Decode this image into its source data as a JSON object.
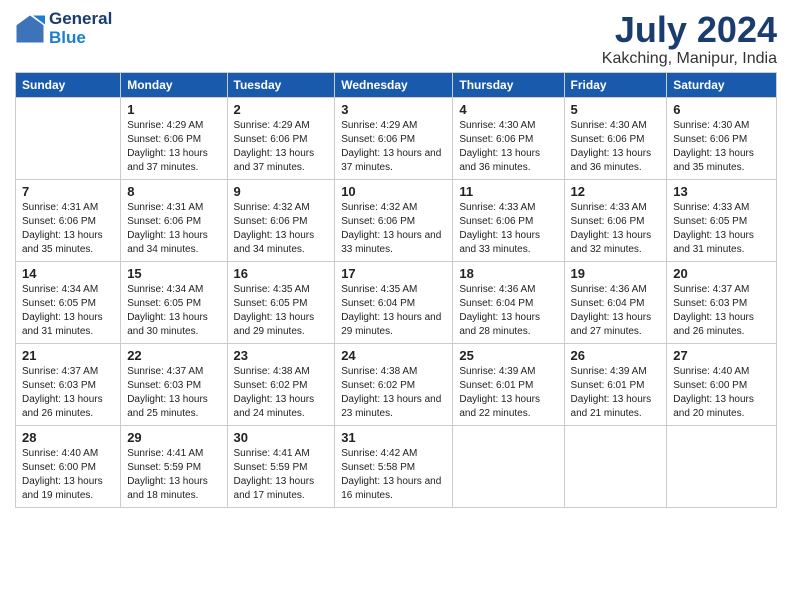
{
  "header": {
    "logo_line1": "General",
    "logo_line2": "Blue",
    "title": "July 2024",
    "subtitle": "Kakching, Manipur, India"
  },
  "days_of_week": [
    "Sunday",
    "Monday",
    "Tuesday",
    "Wednesday",
    "Thursday",
    "Friday",
    "Saturday"
  ],
  "weeks": [
    [
      {
        "day": "",
        "sunrise": "",
        "sunset": "",
        "daylight": ""
      },
      {
        "day": "1",
        "sunrise": "Sunrise: 4:29 AM",
        "sunset": "Sunset: 6:06 PM",
        "daylight": "Daylight: 13 hours and 37 minutes."
      },
      {
        "day": "2",
        "sunrise": "Sunrise: 4:29 AM",
        "sunset": "Sunset: 6:06 PM",
        "daylight": "Daylight: 13 hours and 37 minutes."
      },
      {
        "day": "3",
        "sunrise": "Sunrise: 4:29 AM",
        "sunset": "Sunset: 6:06 PM",
        "daylight": "Daylight: 13 hours and 37 minutes."
      },
      {
        "day": "4",
        "sunrise": "Sunrise: 4:30 AM",
        "sunset": "Sunset: 6:06 PM",
        "daylight": "Daylight: 13 hours and 36 minutes."
      },
      {
        "day": "5",
        "sunrise": "Sunrise: 4:30 AM",
        "sunset": "Sunset: 6:06 PM",
        "daylight": "Daylight: 13 hours and 36 minutes."
      },
      {
        "day": "6",
        "sunrise": "Sunrise: 4:30 AM",
        "sunset": "Sunset: 6:06 PM",
        "daylight": "Daylight: 13 hours and 35 minutes."
      }
    ],
    [
      {
        "day": "7",
        "sunrise": "Sunrise: 4:31 AM",
        "sunset": "Sunset: 6:06 PM",
        "daylight": "Daylight: 13 hours and 35 minutes."
      },
      {
        "day": "8",
        "sunrise": "Sunrise: 4:31 AM",
        "sunset": "Sunset: 6:06 PM",
        "daylight": "Daylight: 13 hours and 34 minutes."
      },
      {
        "day": "9",
        "sunrise": "Sunrise: 4:32 AM",
        "sunset": "Sunset: 6:06 PM",
        "daylight": "Daylight: 13 hours and 34 minutes."
      },
      {
        "day": "10",
        "sunrise": "Sunrise: 4:32 AM",
        "sunset": "Sunset: 6:06 PM",
        "daylight": "Daylight: 13 hours and 33 minutes."
      },
      {
        "day": "11",
        "sunrise": "Sunrise: 4:33 AM",
        "sunset": "Sunset: 6:06 PM",
        "daylight": "Daylight: 13 hours and 33 minutes."
      },
      {
        "day": "12",
        "sunrise": "Sunrise: 4:33 AM",
        "sunset": "Sunset: 6:06 PM",
        "daylight": "Daylight: 13 hours and 32 minutes."
      },
      {
        "day": "13",
        "sunrise": "Sunrise: 4:33 AM",
        "sunset": "Sunset: 6:05 PM",
        "daylight": "Daylight: 13 hours and 31 minutes."
      }
    ],
    [
      {
        "day": "14",
        "sunrise": "Sunrise: 4:34 AM",
        "sunset": "Sunset: 6:05 PM",
        "daylight": "Daylight: 13 hours and 31 minutes."
      },
      {
        "day": "15",
        "sunrise": "Sunrise: 4:34 AM",
        "sunset": "Sunset: 6:05 PM",
        "daylight": "Daylight: 13 hours and 30 minutes."
      },
      {
        "day": "16",
        "sunrise": "Sunrise: 4:35 AM",
        "sunset": "Sunset: 6:05 PM",
        "daylight": "Daylight: 13 hours and 29 minutes."
      },
      {
        "day": "17",
        "sunrise": "Sunrise: 4:35 AM",
        "sunset": "Sunset: 6:04 PM",
        "daylight": "Daylight: 13 hours and 29 minutes."
      },
      {
        "day": "18",
        "sunrise": "Sunrise: 4:36 AM",
        "sunset": "Sunset: 6:04 PM",
        "daylight": "Daylight: 13 hours and 28 minutes."
      },
      {
        "day": "19",
        "sunrise": "Sunrise: 4:36 AM",
        "sunset": "Sunset: 6:04 PM",
        "daylight": "Daylight: 13 hours and 27 minutes."
      },
      {
        "day": "20",
        "sunrise": "Sunrise: 4:37 AM",
        "sunset": "Sunset: 6:03 PM",
        "daylight": "Daylight: 13 hours and 26 minutes."
      }
    ],
    [
      {
        "day": "21",
        "sunrise": "Sunrise: 4:37 AM",
        "sunset": "Sunset: 6:03 PM",
        "daylight": "Daylight: 13 hours and 26 minutes."
      },
      {
        "day": "22",
        "sunrise": "Sunrise: 4:37 AM",
        "sunset": "Sunset: 6:03 PM",
        "daylight": "Daylight: 13 hours and 25 minutes."
      },
      {
        "day": "23",
        "sunrise": "Sunrise: 4:38 AM",
        "sunset": "Sunset: 6:02 PM",
        "daylight": "Daylight: 13 hours and 24 minutes."
      },
      {
        "day": "24",
        "sunrise": "Sunrise: 4:38 AM",
        "sunset": "Sunset: 6:02 PM",
        "daylight": "Daylight: 13 hours and 23 minutes."
      },
      {
        "day": "25",
        "sunrise": "Sunrise: 4:39 AM",
        "sunset": "Sunset: 6:01 PM",
        "daylight": "Daylight: 13 hours and 22 minutes."
      },
      {
        "day": "26",
        "sunrise": "Sunrise: 4:39 AM",
        "sunset": "Sunset: 6:01 PM",
        "daylight": "Daylight: 13 hours and 21 minutes."
      },
      {
        "day": "27",
        "sunrise": "Sunrise: 4:40 AM",
        "sunset": "Sunset: 6:00 PM",
        "daylight": "Daylight: 13 hours and 20 minutes."
      }
    ],
    [
      {
        "day": "28",
        "sunrise": "Sunrise: 4:40 AM",
        "sunset": "Sunset: 6:00 PM",
        "daylight": "Daylight: 13 hours and 19 minutes."
      },
      {
        "day": "29",
        "sunrise": "Sunrise: 4:41 AM",
        "sunset": "Sunset: 5:59 PM",
        "daylight": "Daylight: 13 hours and 18 minutes."
      },
      {
        "day": "30",
        "sunrise": "Sunrise: 4:41 AM",
        "sunset": "Sunset: 5:59 PM",
        "daylight": "Daylight: 13 hours and 17 minutes."
      },
      {
        "day": "31",
        "sunrise": "Sunrise: 4:42 AM",
        "sunset": "Sunset: 5:58 PM",
        "daylight": "Daylight: 13 hours and 16 minutes."
      },
      {
        "day": "",
        "sunrise": "",
        "sunset": "",
        "daylight": ""
      },
      {
        "day": "",
        "sunrise": "",
        "sunset": "",
        "daylight": ""
      },
      {
        "day": "",
        "sunrise": "",
        "sunset": "",
        "daylight": ""
      }
    ]
  ]
}
